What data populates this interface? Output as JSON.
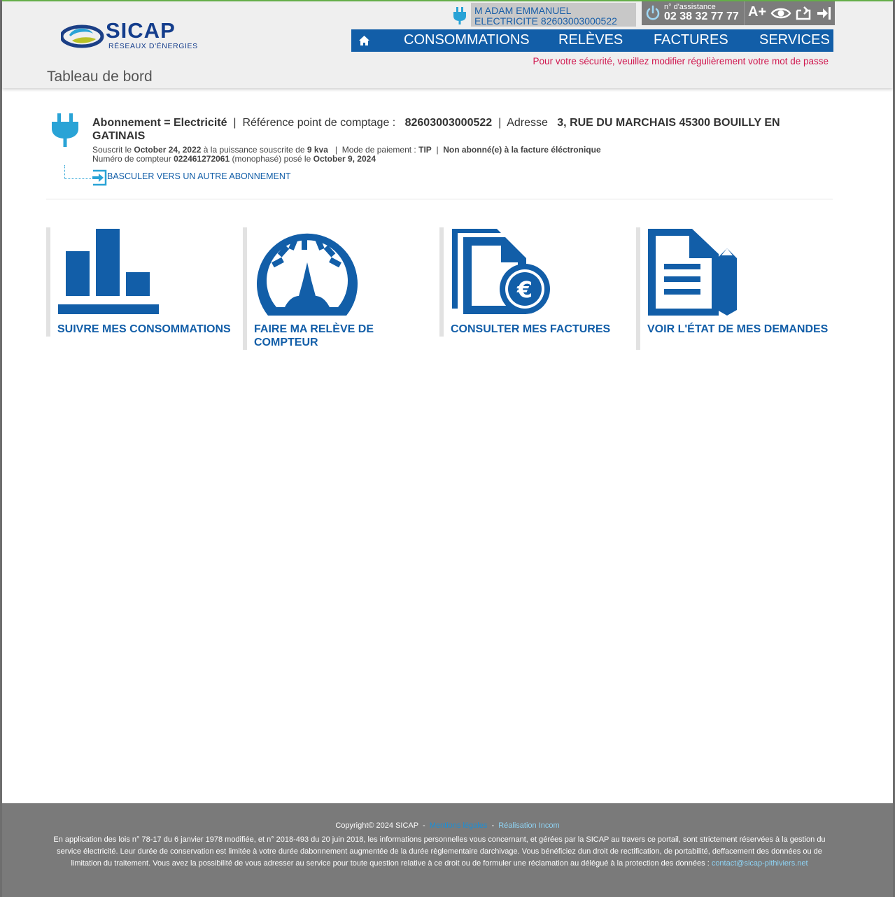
{
  "brand": {
    "name": "SICAP",
    "tagline": "RÉSEAUX D'ÉNERGIES"
  },
  "header": {
    "page_title": "Tableau de bord",
    "user_name": "M ADAM EMMANUEL",
    "user_contract": "ELECTRICITE 82603003000522",
    "assistance_label": "n° d'assistance",
    "assistance_number": "02 38 32 77 77",
    "text_size_label": "A+",
    "security_message": "Pour votre sécurité, veuillez modifier régulièrement votre mot de passe"
  },
  "nav": {
    "items": [
      {
        "label": "CONSOMMATIONS"
      },
      {
        "label": "RELÈVES"
      },
      {
        "label": "FACTURES"
      },
      {
        "label": "SERVICES"
      }
    ]
  },
  "subscription": {
    "abonnement_label": "Abonnement = Electricité",
    "reference_label": "Référence point de comptage :",
    "reference_value": "82603003000522",
    "address_label": "Adresse",
    "address_value": "3, RUE DU MARCHAIS 45300 BOUILLY EN GATINAIS",
    "subscribed_label": "Souscrit le",
    "subscribed_date": "October 24, 2022",
    "power_label": "à la puissance souscrite de",
    "power_value": "9 kva",
    "payment_label": "Mode de paiement :",
    "payment_value": "TIP",
    "einvoice_status": "Non abonné(e) à la facture éléctronique",
    "meter_label": "Numéro de compteur",
    "meter_value": "022461272061",
    "meter_type": "(monophasé)",
    "installed_label": "posé le",
    "installed_date": "October 9, 2024",
    "switch_link": "BASCULER VERS UN AUTRE ABONNEMENT"
  },
  "tiles": [
    {
      "label": "SUIVRE MES CONSOMMATIONS",
      "icon": "bar-chart-icon"
    },
    {
      "label": "FAIRE MA RELÈVE DE COMPTEUR",
      "icon": "gauge-icon"
    },
    {
      "label": "CONSULTER MES FACTURES",
      "icon": "invoice-euro-icon"
    },
    {
      "label": "VOIR L'ÉTAT DE MES DEMANDES",
      "icon": "document-pencil-icon"
    }
  ],
  "footer": {
    "copyright": "Copyright© 2024 SICAP",
    "legal_link": "Mentions légales",
    "realisation_link": "Réalisation Incom",
    "legal_text": "En application des lois n° 78-17 du 6 janvier 1978 modifiée, et n° 2018-493 du 20 juin 2018, les informations personnelles vous concernant, et gérées par la SICAP au travers ce portail, sont strictement réservées à la gestion du service électricité. Leur durée de conservation est limitée à votre durée dabonnement augmentée de la durée règlementaire darchivage. Vous bénéficiez dun droit de rectification, de portabilité, deffacement des données ou de limitation du traitement. Vous avez la possibilité de vous adresser au service pour toute question relative à ce droit ou de formuler une réclamation au délégué à la protection des données :",
    "contact_email": "contact@sicap-pithiviers.net"
  },
  "colors": {
    "brand_blue": "#125ea8",
    "accent_cyan": "#29a3d6",
    "alert_red": "#d0174f",
    "footer_gray": "#7a7a7a"
  }
}
